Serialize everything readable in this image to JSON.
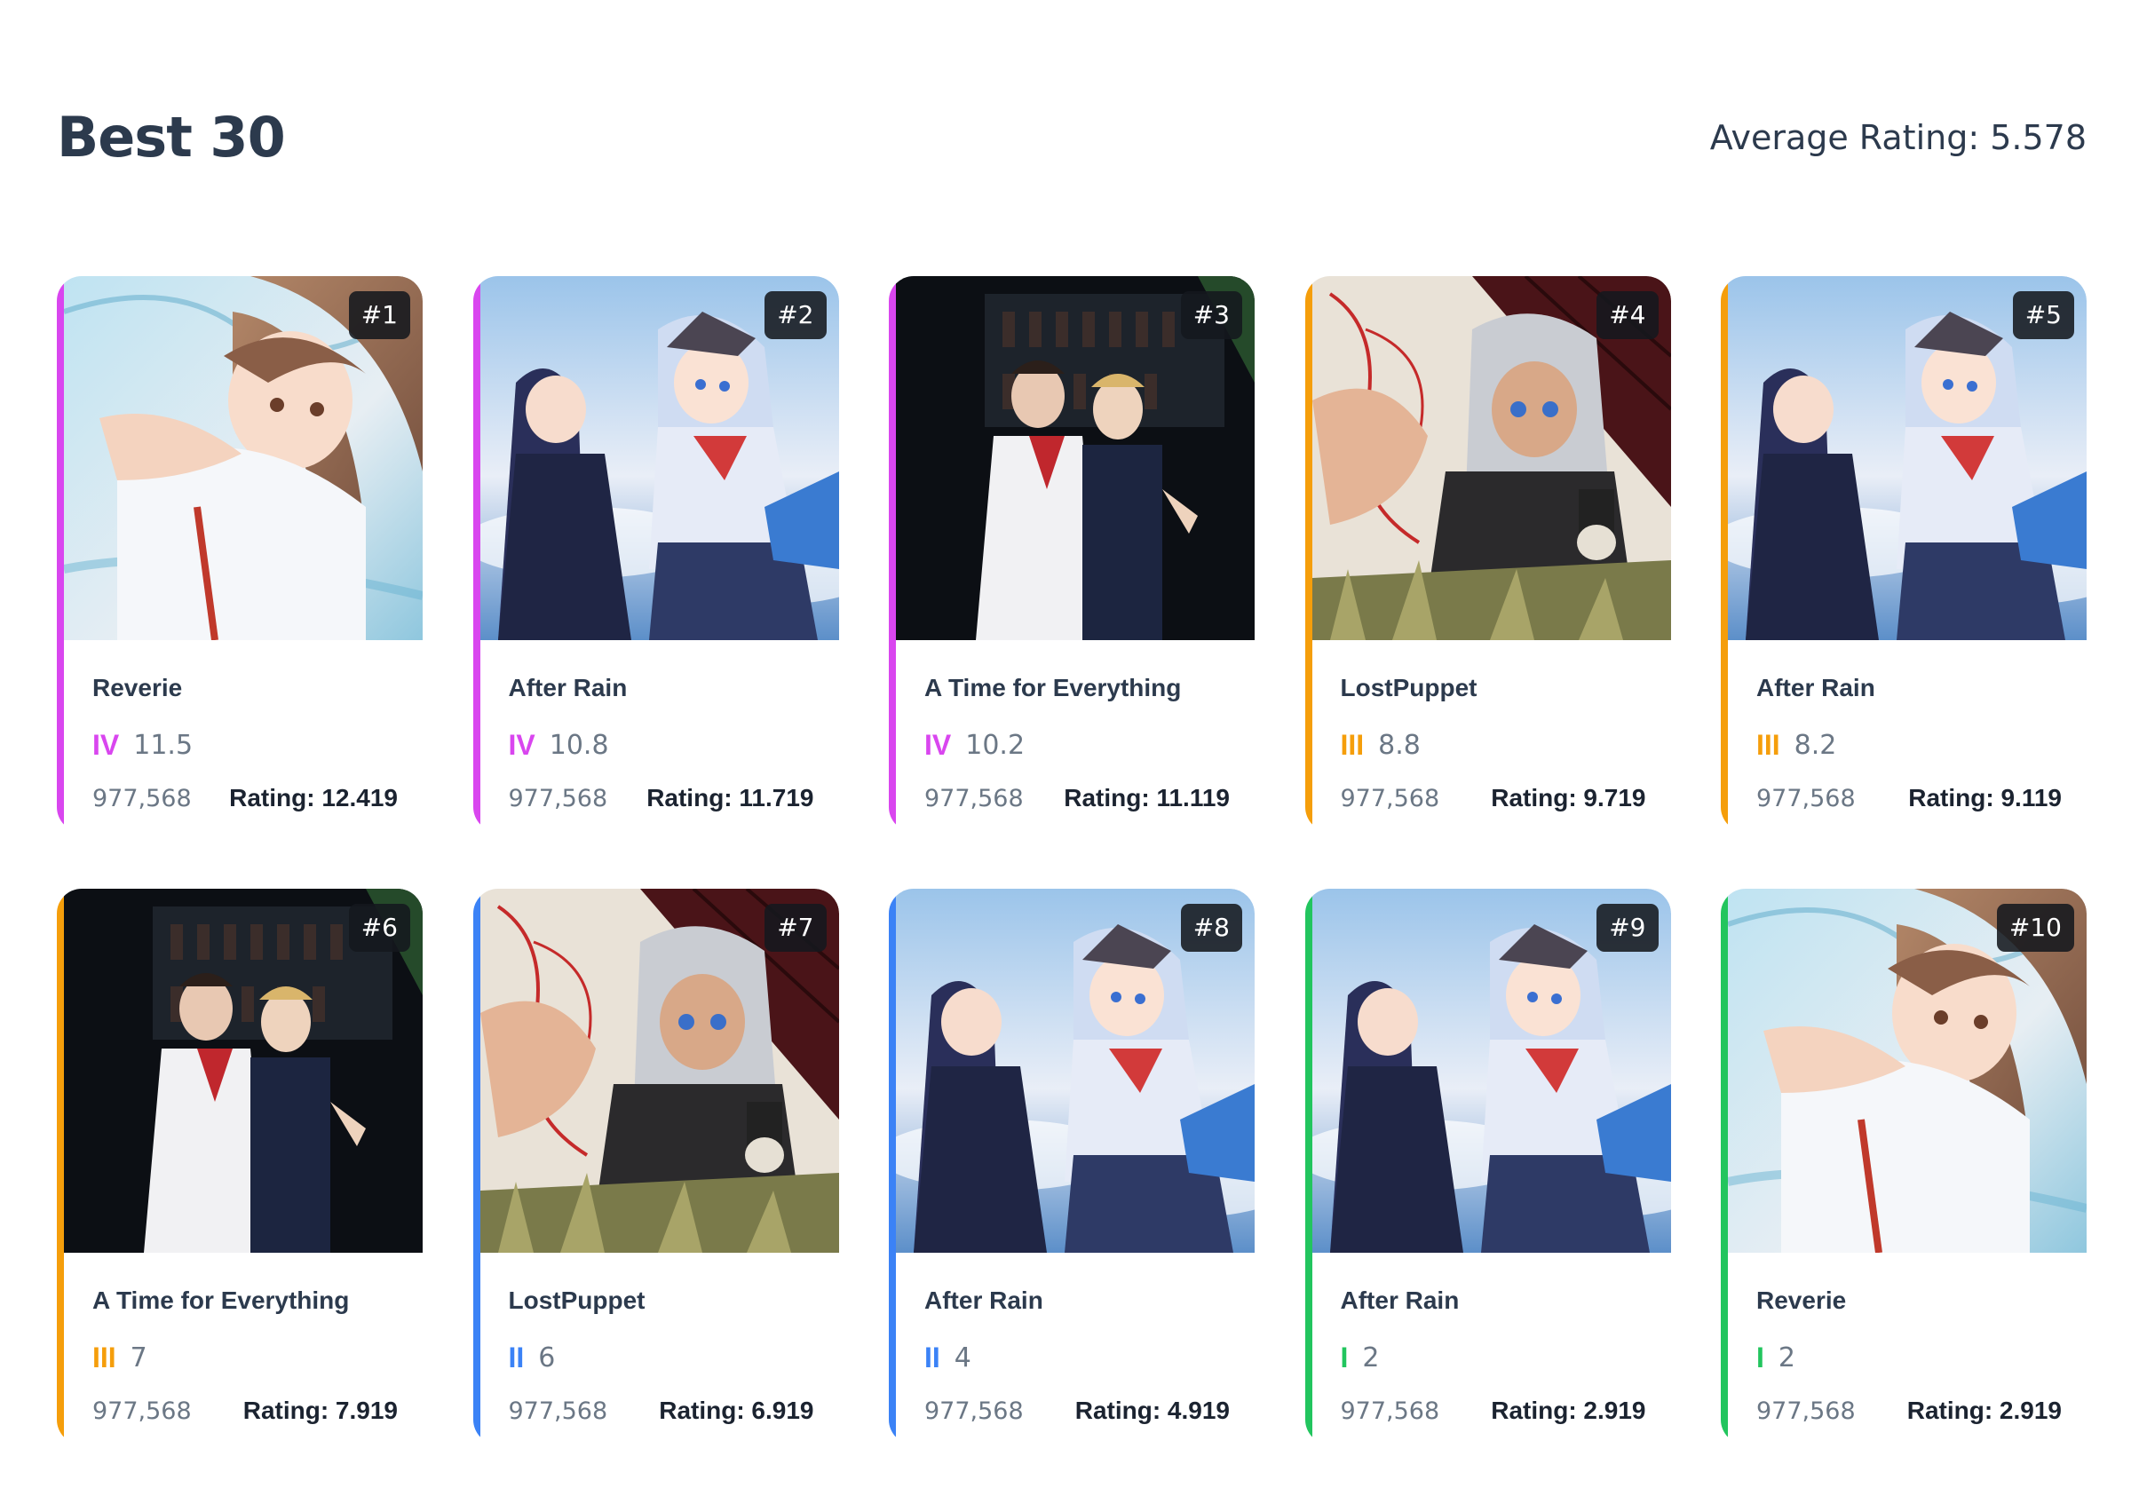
{
  "header": {
    "title": "Best 30",
    "average_rating": "Average Rating: 5.578"
  },
  "colors": {
    "IV": "#d946ef",
    "III": "#f59e0b",
    "II": "#3b82f6",
    "I": "#22c55e"
  },
  "cards": [
    {
      "rank": "#1",
      "song": "Reverie",
      "diff": "IV",
      "level": "11.5",
      "score": "977,568",
      "rating": "Rating: 12.419",
      "art": "reverie"
    },
    {
      "rank": "#2",
      "song": "After Rain",
      "diff": "IV",
      "level": "10.8",
      "score": "977,568",
      "rating": "Rating: 11.719",
      "art": "afterrain"
    },
    {
      "rank": "#3",
      "song": "A Time for Everything",
      "diff": "IV",
      "level": "10.2",
      "score": "977,568",
      "rating": "Rating: 11.119",
      "art": "time"
    },
    {
      "rank": "#4",
      "song": "LostPuppet",
      "diff": "III",
      "level": "8.8",
      "score": "977,568",
      "rating": "Rating: 9.719",
      "art": "puppet"
    },
    {
      "rank": "#5",
      "song": "After Rain",
      "diff": "III",
      "level": "8.2",
      "score": "977,568",
      "rating": "Rating: 9.119",
      "art": "afterrain"
    },
    {
      "rank": "#6",
      "song": "A Time for Everything",
      "diff": "III",
      "level": "7",
      "score": "977,568",
      "rating": "Rating: 7.919",
      "art": "time"
    },
    {
      "rank": "#7",
      "song": "LostPuppet",
      "diff": "II",
      "level": "6",
      "score": "977,568",
      "rating": "Rating: 6.919",
      "art": "puppet"
    },
    {
      "rank": "#8",
      "song": "After Rain",
      "diff": "II",
      "level": "4",
      "score": "977,568",
      "rating": "Rating: 4.919",
      "art": "afterrain"
    },
    {
      "rank": "#9",
      "song": "After Rain",
      "diff": "I",
      "level": "2",
      "score": "977,568",
      "rating": "Rating: 2.919",
      "art": "afterrain"
    },
    {
      "rank": "#10",
      "song": "Reverie",
      "diff": "I",
      "level": "2",
      "score": "977,568",
      "rating": "Rating: 2.919",
      "art": "reverie"
    }
  ]
}
